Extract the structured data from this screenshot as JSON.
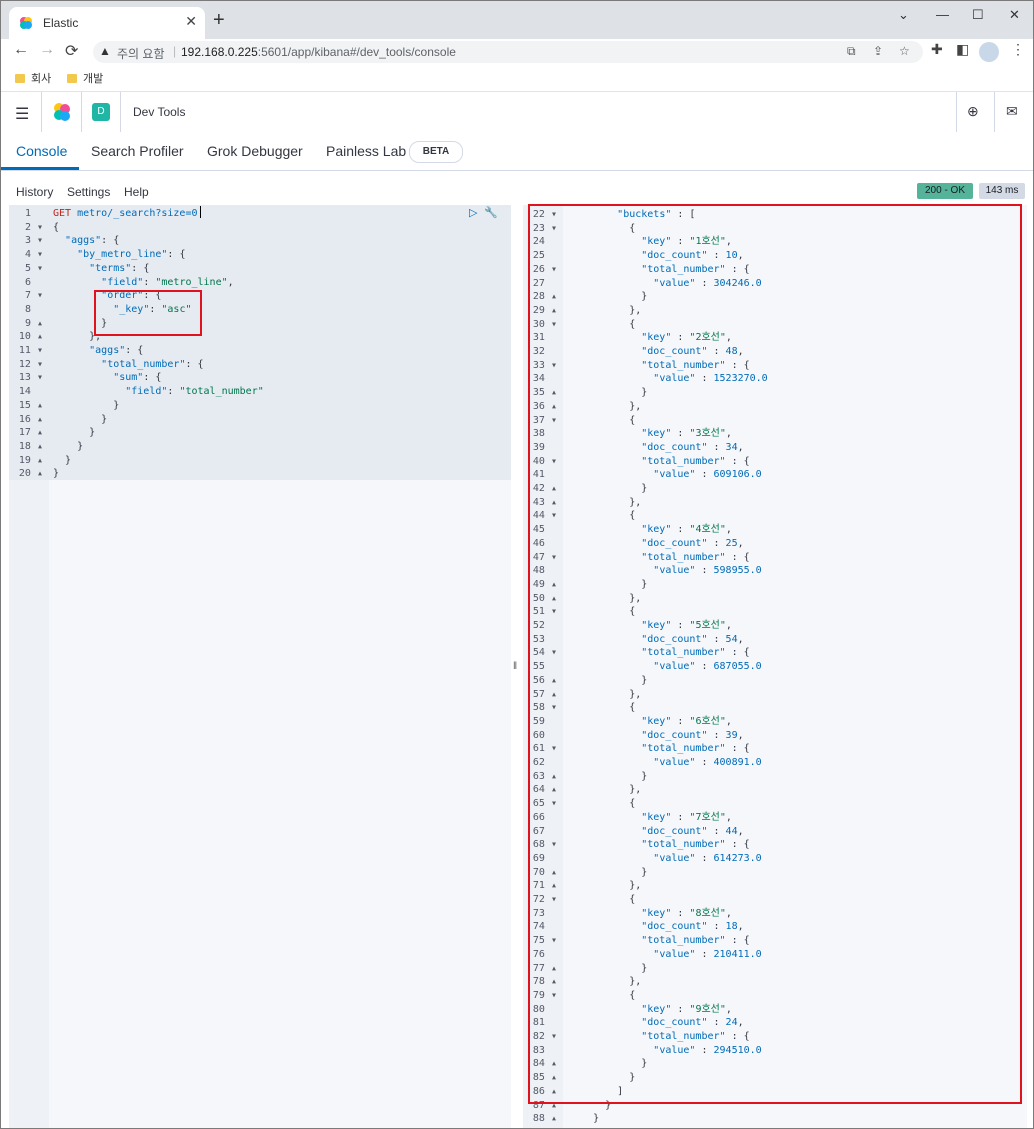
{
  "browser": {
    "tab_title": "Elastic",
    "tab_close": "✕",
    "new_tab": "+",
    "window_controls": [
      "⌄",
      "—",
      "☐",
      "✕"
    ],
    "nav": {
      "back": "←",
      "forward": "→",
      "reload": "⟳"
    },
    "not_secure": "주의 요함",
    "url_host": "192.168.0.225",
    "url_rest": ":5601/app/kibana#/dev_tools/console",
    "bookmarks": [
      "회사",
      "개발"
    ]
  },
  "header": {
    "space_initial": "D",
    "app_title": "Dev Tools"
  },
  "tabs": [
    "Console",
    "Search Profiler",
    "Grok Debugger",
    "Painless Lab"
  ],
  "beta_label": "BETA",
  "menu": [
    "History",
    "Settings",
    "Help"
  ],
  "status": {
    "code": "200 - OK",
    "time": "143 ms"
  },
  "request_lines": [
    {
      "n": "1",
      "f": "",
      "t": [
        [
          "m",
          "GET"
        ],
        [
          "k",
          " metro/_search?size=0"
        ]
      ]
    },
    {
      "n": "2",
      "f": "▾",
      "t": [
        [
          "p",
          "{"
        ]
      ]
    },
    {
      "n": "3",
      "f": "▾",
      "t": [
        [
          "p",
          "  "
        ],
        [
          "k",
          "\"aggs\""
        ],
        [
          "p",
          ": {"
        ]
      ]
    },
    {
      "n": "4",
      "f": "▾",
      "t": [
        [
          "p",
          "    "
        ],
        [
          "k",
          "\"by_metro_line\""
        ],
        [
          "p",
          ": {"
        ]
      ]
    },
    {
      "n": "5",
      "f": "▾",
      "t": [
        [
          "p",
          "      "
        ],
        [
          "k",
          "\"terms\""
        ],
        [
          "p",
          ": {"
        ]
      ]
    },
    {
      "n": "6",
      "f": "",
      "t": [
        [
          "p",
          "        "
        ],
        [
          "k",
          "\"field\""
        ],
        [
          "p",
          ": "
        ],
        [
          "s",
          "\"metro_line\""
        ],
        [
          "p",
          ","
        ]
      ]
    },
    {
      "n": "7",
      "f": "▾",
      "t": [
        [
          "p",
          "        "
        ],
        [
          "k",
          "\"order\""
        ],
        [
          "p",
          ": {"
        ]
      ]
    },
    {
      "n": "8",
      "f": "",
      "t": [
        [
          "p",
          "          "
        ],
        [
          "k",
          "\"_key\""
        ],
        [
          "p",
          ": "
        ],
        [
          "s",
          "\"asc\""
        ]
      ]
    },
    {
      "n": "9",
      "f": "▴",
      "t": [
        [
          "p",
          "        }"
        ]
      ]
    },
    {
      "n": "10",
      "f": "▴",
      "t": [
        [
          "p",
          "      },"
        ]
      ]
    },
    {
      "n": "11",
      "f": "▾",
      "t": [
        [
          "p",
          "      "
        ],
        [
          "k",
          "\"aggs\""
        ],
        [
          "p",
          ": {"
        ]
      ]
    },
    {
      "n": "12",
      "f": "▾",
      "t": [
        [
          "p",
          "        "
        ],
        [
          "k",
          "\"total_number\""
        ],
        [
          "p",
          ": {"
        ]
      ]
    },
    {
      "n": "13",
      "f": "▾",
      "t": [
        [
          "p",
          "          "
        ],
        [
          "k",
          "\"sum\""
        ],
        [
          "p",
          ": {"
        ]
      ]
    },
    {
      "n": "14",
      "f": "",
      "t": [
        [
          "p",
          "            "
        ],
        [
          "k",
          "\"field\""
        ],
        [
          "p",
          ": "
        ],
        [
          "s",
          "\"total_number\""
        ]
      ]
    },
    {
      "n": "15",
      "f": "▴",
      "t": [
        [
          "p",
          "          }"
        ]
      ]
    },
    {
      "n": "16",
      "f": "▴",
      "t": [
        [
          "p",
          "        }"
        ]
      ]
    },
    {
      "n": "17",
      "f": "▴",
      "t": [
        [
          "p",
          "      }"
        ]
      ]
    },
    {
      "n": "18",
      "f": "▴",
      "t": [
        [
          "p",
          "    }"
        ]
      ]
    },
    {
      "n": "19",
      "f": "▴",
      "t": [
        [
          "p",
          "  }"
        ]
      ]
    },
    {
      "n": "20",
      "f": "▴",
      "t": [
        [
          "p",
          "}"
        ]
      ]
    }
  ],
  "response_header": [
    {
      "n": "22",
      "f": "▾",
      "t": [
        [
          "p",
          "        "
        ],
        [
          "k",
          "\"buckets\""
        ],
        [
          "p",
          " : ["
        ]
      ]
    },
    {
      "n": "23",
      "f": "▾",
      "t": [
        [
          "p",
          "          {"
        ]
      ]
    }
  ],
  "buckets": [
    {
      "key": "1호선",
      "doc_count": "10",
      "value": "304246.0"
    },
    {
      "key": "2호선",
      "doc_count": "48",
      "value": "1523270.0"
    },
    {
      "key": "3호선",
      "doc_count": "34",
      "value": "609106.0"
    },
    {
      "key": "4호선",
      "doc_count": "25",
      "value": "598955.0"
    },
    {
      "key": "5호선",
      "doc_count": "54",
      "value": "687055.0"
    },
    {
      "key": "6호선",
      "doc_count": "39",
      "value": "400891.0"
    },
    {
      "key": "7호선",
      "doc_count": "44",
      "value": "614273.0"
    },
    {
      "key": "8호선",
      "doc_count": "18",
      "value": "210411.0"
    },
    {
      "key": "9호선",
      "doc_count": "24",
      "value": "294510.0"
    }
  ],
  "response_footer": [
    {
      "n": "85",
      "f": "▴",
      "t": [
        [
          "p",
          "          }"
        ]
      ]
    },
    {
      "n": "86",
      "f": "▴",
      "t": [
        [
          "p",
          "        ]"
        ]
      ]
    },
    {
      "n": "87",
      "f": "▴",
      "t": [
        [
          "p",
          "      }"
        ]
      ]
    },
    {
      "n": "88",
      "f": "▴",
      "t": [
        [
          "p",
          "    }"
        ]
      ]
    }
  ],
  "colors": {
    "accent": "#006bb8",
    "ok": "#54b399",
    "highlight_box": "#e0121d",
    "string": "#00764d"
  }
}
